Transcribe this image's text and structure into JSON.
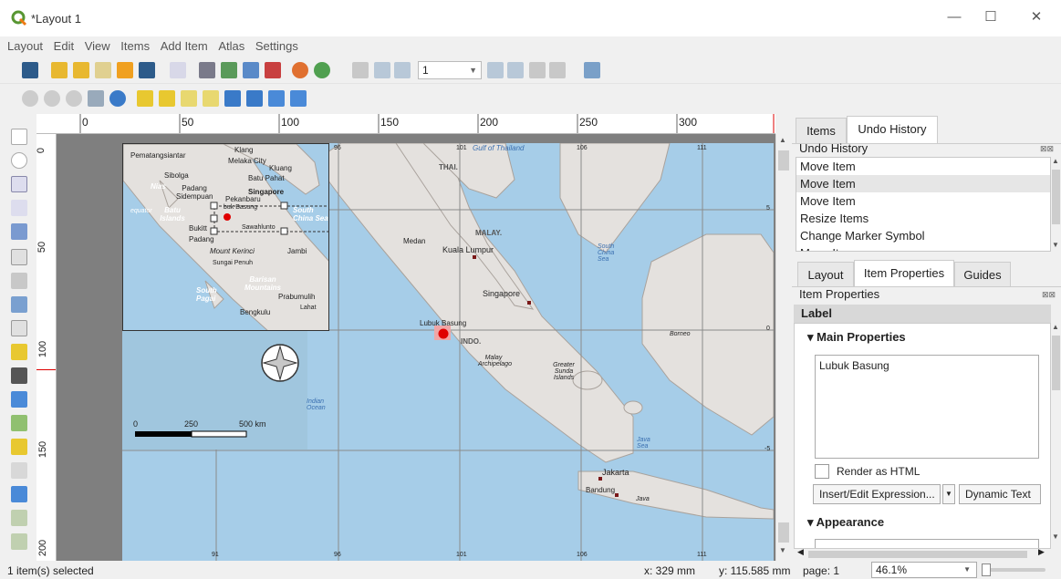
{
  "window": {
    "title": "*Layout 1",
    "min_icon": "minimize-icon",
    "max_icon": "maximize-icon",
    "close_icon": "close-icon"
  },
  "menu": [
    "Layout",
    "Edit",
    "View",
    "Items",
    "Add Item",
    "Atlas",
    "Settings"
  ],
  "toolbar": {
    "page_field": "1"
  },
  "ruler": {
    "h_ticks": [
      "0",
      "50",
      "100",
      "150",
      "200",
      "250",
      "300"
    ],
    "v_ticks": [
      "0",
      "50",
      "100",
      "150",
      "200"
    ]
  },
  "panel": {
    "top_tabs": [
      "Items",
      "Undo History"
    ],
    "undo_title": "Undo History",
    "undo_items": [
      "Move Item",
      "Move Item",
      "Move Item",
      "Resize Items",
      "Change Marker Symbol",
      "Move Item"
    ],
    "bottom_tabs": [
      "Layout",
      "Item Properties",
      "Guides"
    ],
    "props_title": "Item Properties",
    "label_header": "Label",
    "main_props": "Main Properties",
    "label_text": "Lubuk Basung",
    "render_html": "Render as HTML",
    "insert_expr": "Insert/Edit Expression...",
    "dynamic_text": "Dynamic Text",
    "appearance": "Appearance"
  },
  "map": {
    "main_labels": {
      "gulf": "Gulf of Thailand",
      "thai": "THAI.",
      "malay": "MALAY.",
      "medan": "Medan",
      "kl": "Kuala Lumpur",
      "scs": "South China Sea",
      "singapore": "Singapore",
      "lubuk": "Lubuk Basung",
      "indo": "INDO.",
      "malay_arch": "Malay Archipelago",
      "greater_sunda": "Greater Sunda Islands",
      "borneo": "Borneo",
      "java_sea": "Java Sea",
      "jakarta": "Jakarta",
      "bandung": "Bandung",
      "java": "Java",
      "indian_ocean": "Indian Ocean"
    },
    "grid_top": [
      "96",
      "101",
      "106",
      "111"
    ],
    "grid_bottom": [
      "91",
      "96",
      "101",
      "106",
      "111"
    ],
    "grid_right": [
      "5",
      "0",
      "-5"
    ],
    "inset_labels": {
      "pematang": "Pematangsiantar",
      "klang": "Klang",
      "melaka": "Melaka City",
      "kluang": "Kluang",
      "sibolga": "Sibolga",
      "batu_pahat": "Batu Pahat",
      "nias": "Nias",
      "padang_sid": "Padang Sidempuan",
      "singapore": "Singapore",
      "pekanbaru": "Pekanbaru",
      "equator": "equator",
      "batu_islands": "Batu Islands",
      "lubuk": "buk Basung",
      "south_cs": "South China Sea",
      "bukitt": "Bukitt",
      "sawahlunto": "Sawahlunto",
      "padang": "Padang",
      "kerinci": "Mount Kerinci",
      "jambi": "Jambi",
      "sungai": "Sungai Penuh",
      "barisan": "Barisan Mountains",
      "south_pagai": "South Pagai",
      "prabumulih": "Prabumulih",
      "lahat": "Lahat",
      "bengkulu": "Bengkulu"
    },
    "scale": {
      "l0": "0",
      "l1": "250",
      "l2": "500 km"
    }
  },
  "status": {
    "selected": "1 item(s) selected",
    "x": "x: 329 mm",
    "y": "y: 115.585 mm",
    "page": "page: 1",
    "zoom": "46.1%"
  }
}
